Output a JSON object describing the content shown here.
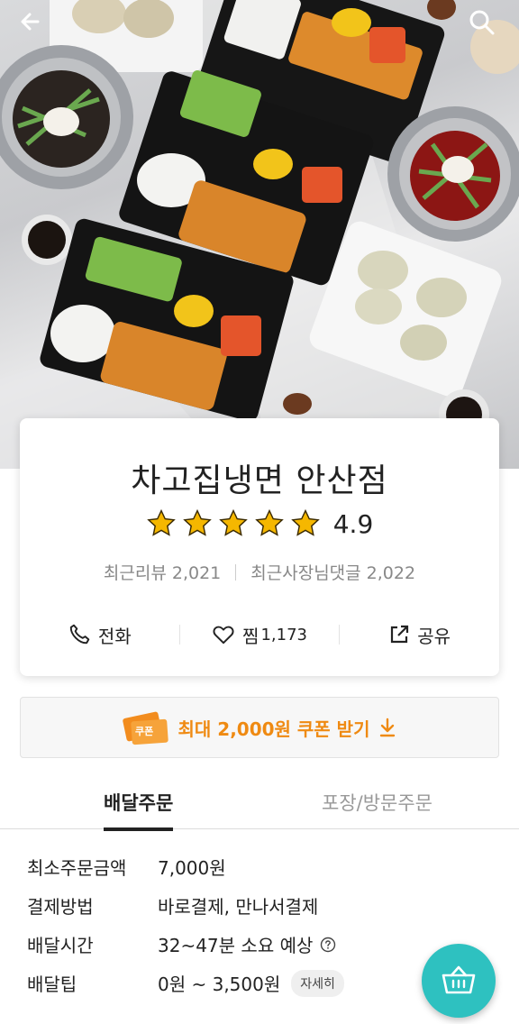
{
  "store": {
    "name": "차고집냉면 안산점",
    "rating": "4.9",
    "stars": 5,
    "recent_reviews": "최근리뷰 2,021",
    "owner_replies": "최근사장님댓글 2,022"
  },
  "actions": {
    "call": "전화",
    "favorite": "찜",
    "favorite_count": "1,173",
    "share": "공유"
  },
  "coupon": {
    "icon_text": "쿠폰",
    "label": "최대 2,000원 쿠폰 받기"
  },
  "tabs": [
    {
      "label": "배달주문",
      "active": true
    },
    {
      "label": "포장/방문주문",
      "active": false
    }
  ],
  "delivery_info": {
    "min_order_label": "최소주문금액",
    "min_order_value": "7,000원",
    "payment_label": "결제방법",
    "payment_value": "바로결제, 만나서결제",
    "time_label": "배달시간",
    "time_value": "32~47분 소요 예상",
    "tip_label": "배달팁",
    "tip_value": "0원 ~ 3,500원",
    "tip_detail": "자세히"
  },
  "icons": {
    "back": "arrow-left-icon",
    "search": "search-icon",
    "phone": "phone-icon",
    "heart": "heart-icon",
    "share": "share-icon",
    "download": "download-arrow-icon",
    "help": "question-circle-icon",
    "cart": "basket-icon"
  },
  "colors": {
    "star": "#f5b700",
    "coupon_accent": "#ef8a12",
    "cart_button": "#2ec1c0"
  }
}
